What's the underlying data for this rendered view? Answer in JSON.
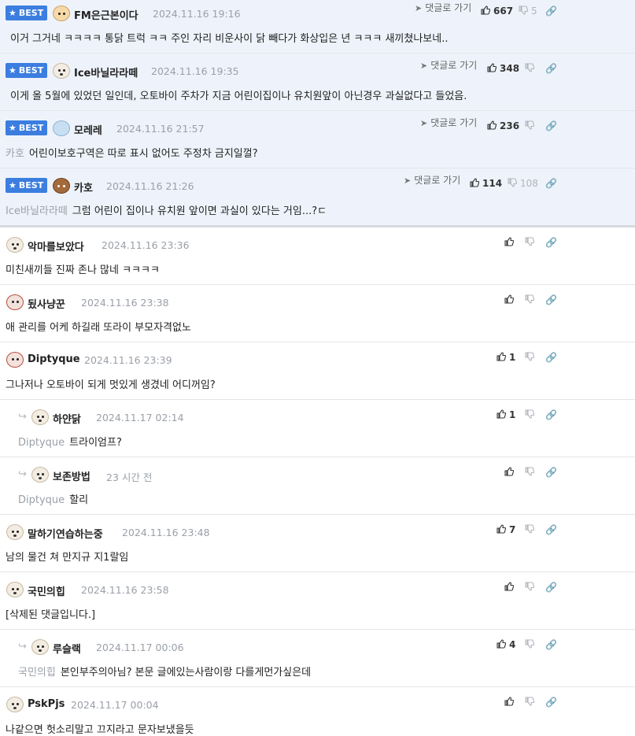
{
  "labels": {
    "best": "BEST",
    "goto_reply": "댓글로 가기"
  },
  "best_comments": [
    {
      "nick": "FM은근본이다",
      "avatar": "fox",
      "date": "2024.11.16 19:16",
      "mention": "",
      "text": "이거 그거네 ㅋㅋㅋㅋ 통닭 트럭 ㅋㅋ 주인 자리 비운사이 닭 빼다가 화상입은 년 ㅋㅋㅋ 새끼쳤나보네..",
      "up": "667",
      "down": "5"
    },
    {
      "nick": "Ice바닐라라떼",
      "avatar": "ice",
      "date": "2024.11.16 19:35",
      "mention": "",
      "text": "이게 올 5월에 있었던 일인데, 오토바이 주차가 지금 어린이집이나 유치원앞이 아닌경우 과실없다고 들었음.",
      "up": "348",
      "down": ""
    },
    {
      "nick": "모레레",
      "avatar": "ice",
      "date": "2024.11.16 21:57",
      "mention": "카호",
      "text": "어린이보호구역은 따로 표시 없어도 주정차 금지일껄?",
      "up": "236",
      "down": ""
    },
    {
      "nick": "카호",
      "avatar": "bear",
      "date": "2024.11.16 21:26",
      "mention": "Ice바닐라라떼",
      "text": "그럼 어린이 집이나 유치원 앞이면 과실이 있다는 거임...?ㄷ",
      "up": "114",
      "down": "108"
    }
  ],
  "comments": [
    {
      "nick": "악마를보았다",
      "avatar": "dog",
      "date": "2024.11.16 23:36",
      "mention": "",
      "text": "미친새끼들 진짜 존나 많네 ㅋㅋㅋㅋ",
      "up": "",
      "reply": false
    },
    {
      "nick": "됬사냥꾼",
      "avatar": "red",
      "date": "2024.11.16 23:38",
      "mention": "",
      "text": "애 관리를 어케 하길래 또라이 부모자격없노",
      "up": "",
      "reply": false
    },
    {
      "nick": "Diptyque",
      "avatar": "red",
      "date": "2024.11.16 23:39",
      "mention": "",
      "text": "그나저나 오토바이 되게 멋있게 생겼네 어디꺼임?",
      "up": "1",
      "reply": false
    },
    {
      "nick": "하얀닭",
      "avatar": "dog",
      "date": "2024.11.17 02:14",
      "mention": "Diptyque",
      "text": "트라이엄프?",
      "up": "1",
      "reply": true
    },
    {
      "nick": "보존방법",
      "avatar": "dog",
      "date": "23 시간 전",
      "mention": "Diptyque",
      "text": "할리",
      "up": "",
      "reply": true
    },
    {
      "nick": "말하기연습하는중",
      "avatar": "dog",
      "date": "2024.11.16 23:48",
      "mention": "",
      "text": "남의 물건 쳐 만지규 지1랄임",
      "up": "7",
      "reply": false
    },
    {
      "nick": "국민의힙",
      "avatar": "dog",
      "date": "2024.11.16 23:58",
      "mention": "",
      "text": "[삭제된 댓글입니다.]",
      "up": "",
      "reply": false
    },
    {
      "nick": "루슬랙",
      "avatar": "dog",
      "date": "2024.11.17 00:06",
      "mention": "국민의힙",
      "text": "본인부주의아님? 본문 글에있는사람이랑 다를게먼가싶은데",
      "up": "4",
      "reply": true
    },
    {
      "nick": "PskPjs",
      "avatar": "dog",
      "date": "2024.11.17 00:04",
      "mention": "",
      "text": "나같으면 헛소리말고 끄지라고 문자보냈을듯",
      "up": "",
      "reply": false
    }
  ],
  "colors": {
    "accent": "#3b7ee0",
    "best_bg": "#eef3fb",
    "muted": "#9aa0a8"
  },
  "icons": [
    "star-icon",
    "thumbs-up-icon",
    "thumbs-down-icon",
    "link-icon",
    "paper-plane-icon",
    "reply-arrow-icon"
  ]
}
